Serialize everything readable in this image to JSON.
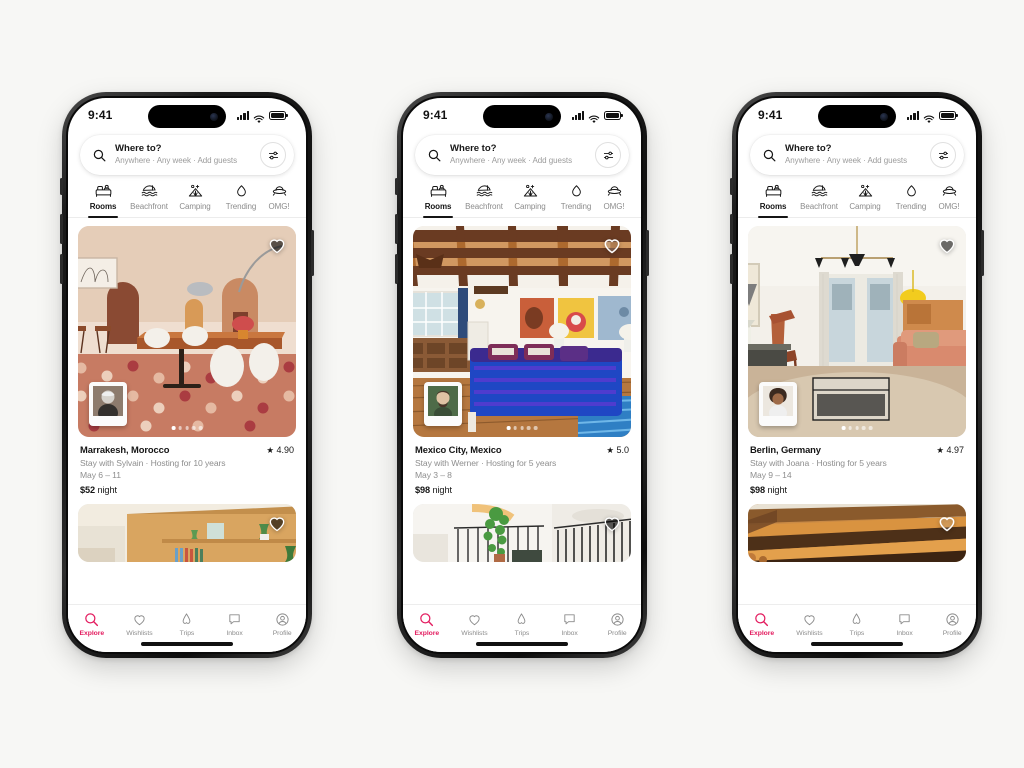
{
  "background_color": "#f7f7f5",
  "accent_color": "#e31c5f",
  "phones": [
    {
      "status_bar": {
        "time": "9:41",
        "signal_icon": "cellular-signal-icon",
        "wifi_icon": "wifi-icon",
        "battery_icon": "battery-icon"
      },
      "search": {
        "title": "Where to?",
        "subtitle": "Anywhere · Any week · Add guests",
        "search_icon": "search-icon",
        "filter_icon": "filter-sliders-icon"
      },
      "categories": [
        {
          "label": "Rooms",
          "icon": "bed-icon",
          "active": true
        },
        {
          "label": "Beachfront",
          "icon": "beach-umbrella-icon",
          "active": false
        },
        {
          "label": "Camping",
          "icon": "tent-icon",
          "active": false
        },
        {
          "label": "Trending",
          "icon": "flame-icon",
          "active": false
        },
        {
          "label": "OMG!",
          "icon": "ufo-icon",
          "active": false
        }
      ],
      "listing": {
        "title": "Marrakesh, Morocco",
        "rating": "4.90",
        "host": "Stay with Sylvain · Hosting for 10 years",
        "dates": "May 6 – 11",
        "price": "$52",
        "price_unit": "night",
        "photo_dots": 5,
        "active_dot": 1,
        "heart_icon": "heart-icon",
        "avatar_name": "host-avatar"
      },
      "next_listing": {
        "heart_icon": "heart-icon"
      },
      "tabs": [
        {
          "label": "Explore",
          "icon": "search-icon",
          "active": true
        },
        {
          "label": "Wishlists",
          "icon": "heart-outline-icon",
          "active": false
        },
        {
          "label": "Trips",
          "icon": "airbnb-belo-icon",
          "active": false
        },
        {
          "label": "Inbox",
          "icon": "message-bubble-icon",
          "active": false
        },
        {
          "label": "Profile",
          "icon": "user-circle-icon",
          "active": false
        }
      ]
    },
    {
      "status_bar": {
        "time": "9:41",
        "signal_icon": "cellular-signal-icon",
        "wifi_icon": "wifi-icon",
        "battery_icon": "battery-icon"
      },
      "search": {
        "title": "Where to?",
        "subtitle": "Anywhere · Any week · Add guests",
        "search_icon": "search-icon",
        "filter_icon": "filter-sliders-icon"
      },
      "categories": [
        {
          "label": "Rooms",
          "icon": "bed-icon",
          "active": true
        },
        {
          "label": "Beachfront",
          "icon": "beach-umbrella-icon",
          "active": false
        },
        {
          "label": "Camping",
          "icon": "tent-icon",
          "active": false
        },
        {
          "label": "Trending",
          "icon": "flame-icon",
          "active": false
        },
        {
          "label": "OMG!",
          "icon": "ufo-icon",
          "active": false
        }
      ],
      "listing": {
        "title": "Mexico City, Mexico",
        "rating": "5.0",
        "host": "Stay with Werner · Hosting for 5 years",
        "dates": "May 3 – 8",
        "price": "$98",
        "price_unit": "night",
        "photo_dots": 5,
        "active_dot": 1,
        "heart_icon": "heart-icon",
        "avatar_name": "host-avatar"
      },
      "next_listing": {
        "heart_icon": "heart-icon"
      },
      "tabs": [
        {
          "label": "Explore",
          "icon": "search-icon",
          "active": true
        },
        {
          "label": "Wishlists",
          "icon": "heart-outline-icon",
          "active": false
        },
        {
          "label": "Trips",
          "icon": "airbnb-belo-icon",
          "active": false
        },
        {
          "label": "Inbox",
          "icon": "message-bubble-icon",
          "active": false
        },
        {
          "label": "Profile",
          "icon": "user-circle-icon",
          "active": false
        }
      ]
    },
    {
      "status_bar": {
        "time": "9:41",
        "signal_icon": "cellular-signal-icon",
        "wifi_icon": "wifi-icon",
        "battery_icon": "battery-icon"
      },
      "search": {
        "title": "Where to?",
        "subtitle": "Anywhere · Any week · Add guests",
        "search_icon": "search-icon",
        "filter_icon": "filter-sliders-icon"
      },
      "categories": [
        {
          "label": "Rooms",
          "icon": "bed-icon",
          "active": true
        },
        {
          "label": "Beachfront",
          "icon": "beach-umbrella-icon",
          "active": false
        },
        {
          "label": "Camping",
          "icon": "tent-icon",
          "active": false
        },
        {
          "label": "Trending",
          "icon": "flame-icon",
          "active": false
        },
        {
          "label": "OMG!",
          "icon": "ufo-icon",
          "active": false
        }
      ],
      "listing": {
        "title": "Berlin, Germany",
        "rating": "4.97",
        "host": "Stay with Joana · Hosting for 5 years",
        "dates": "May 9 – 14",
        "price": "$98",
        "price_unit": "night",
        "photo_dots": 5,
        "active_dot": 1,
        "heart_icon": "heart-icon",
        "avatar_name": "host-avatar"
      },
      "next_listing": {
        "heart_icon": "heart-icon"
      },
      "tabs": [
        {
          "label": "Explore",
          "icon": "search-icon",
          "active": true
        },
        {
          "label": "Wishlists",
          "icon": "heart-outline-icon",
          "active": false
        },
        {
          "label": "Trips",
          "icon": "airbnb-belo-icon",
          "active": false
        },
        {
          "label": "Inbox",
          "icon": "message-bubble-icon",
          "active": false
        },
        {
          "label": "Profile",
          "icon": "user-circle-icon",
          "active": false
        }
      ]
    }
  ]
}
